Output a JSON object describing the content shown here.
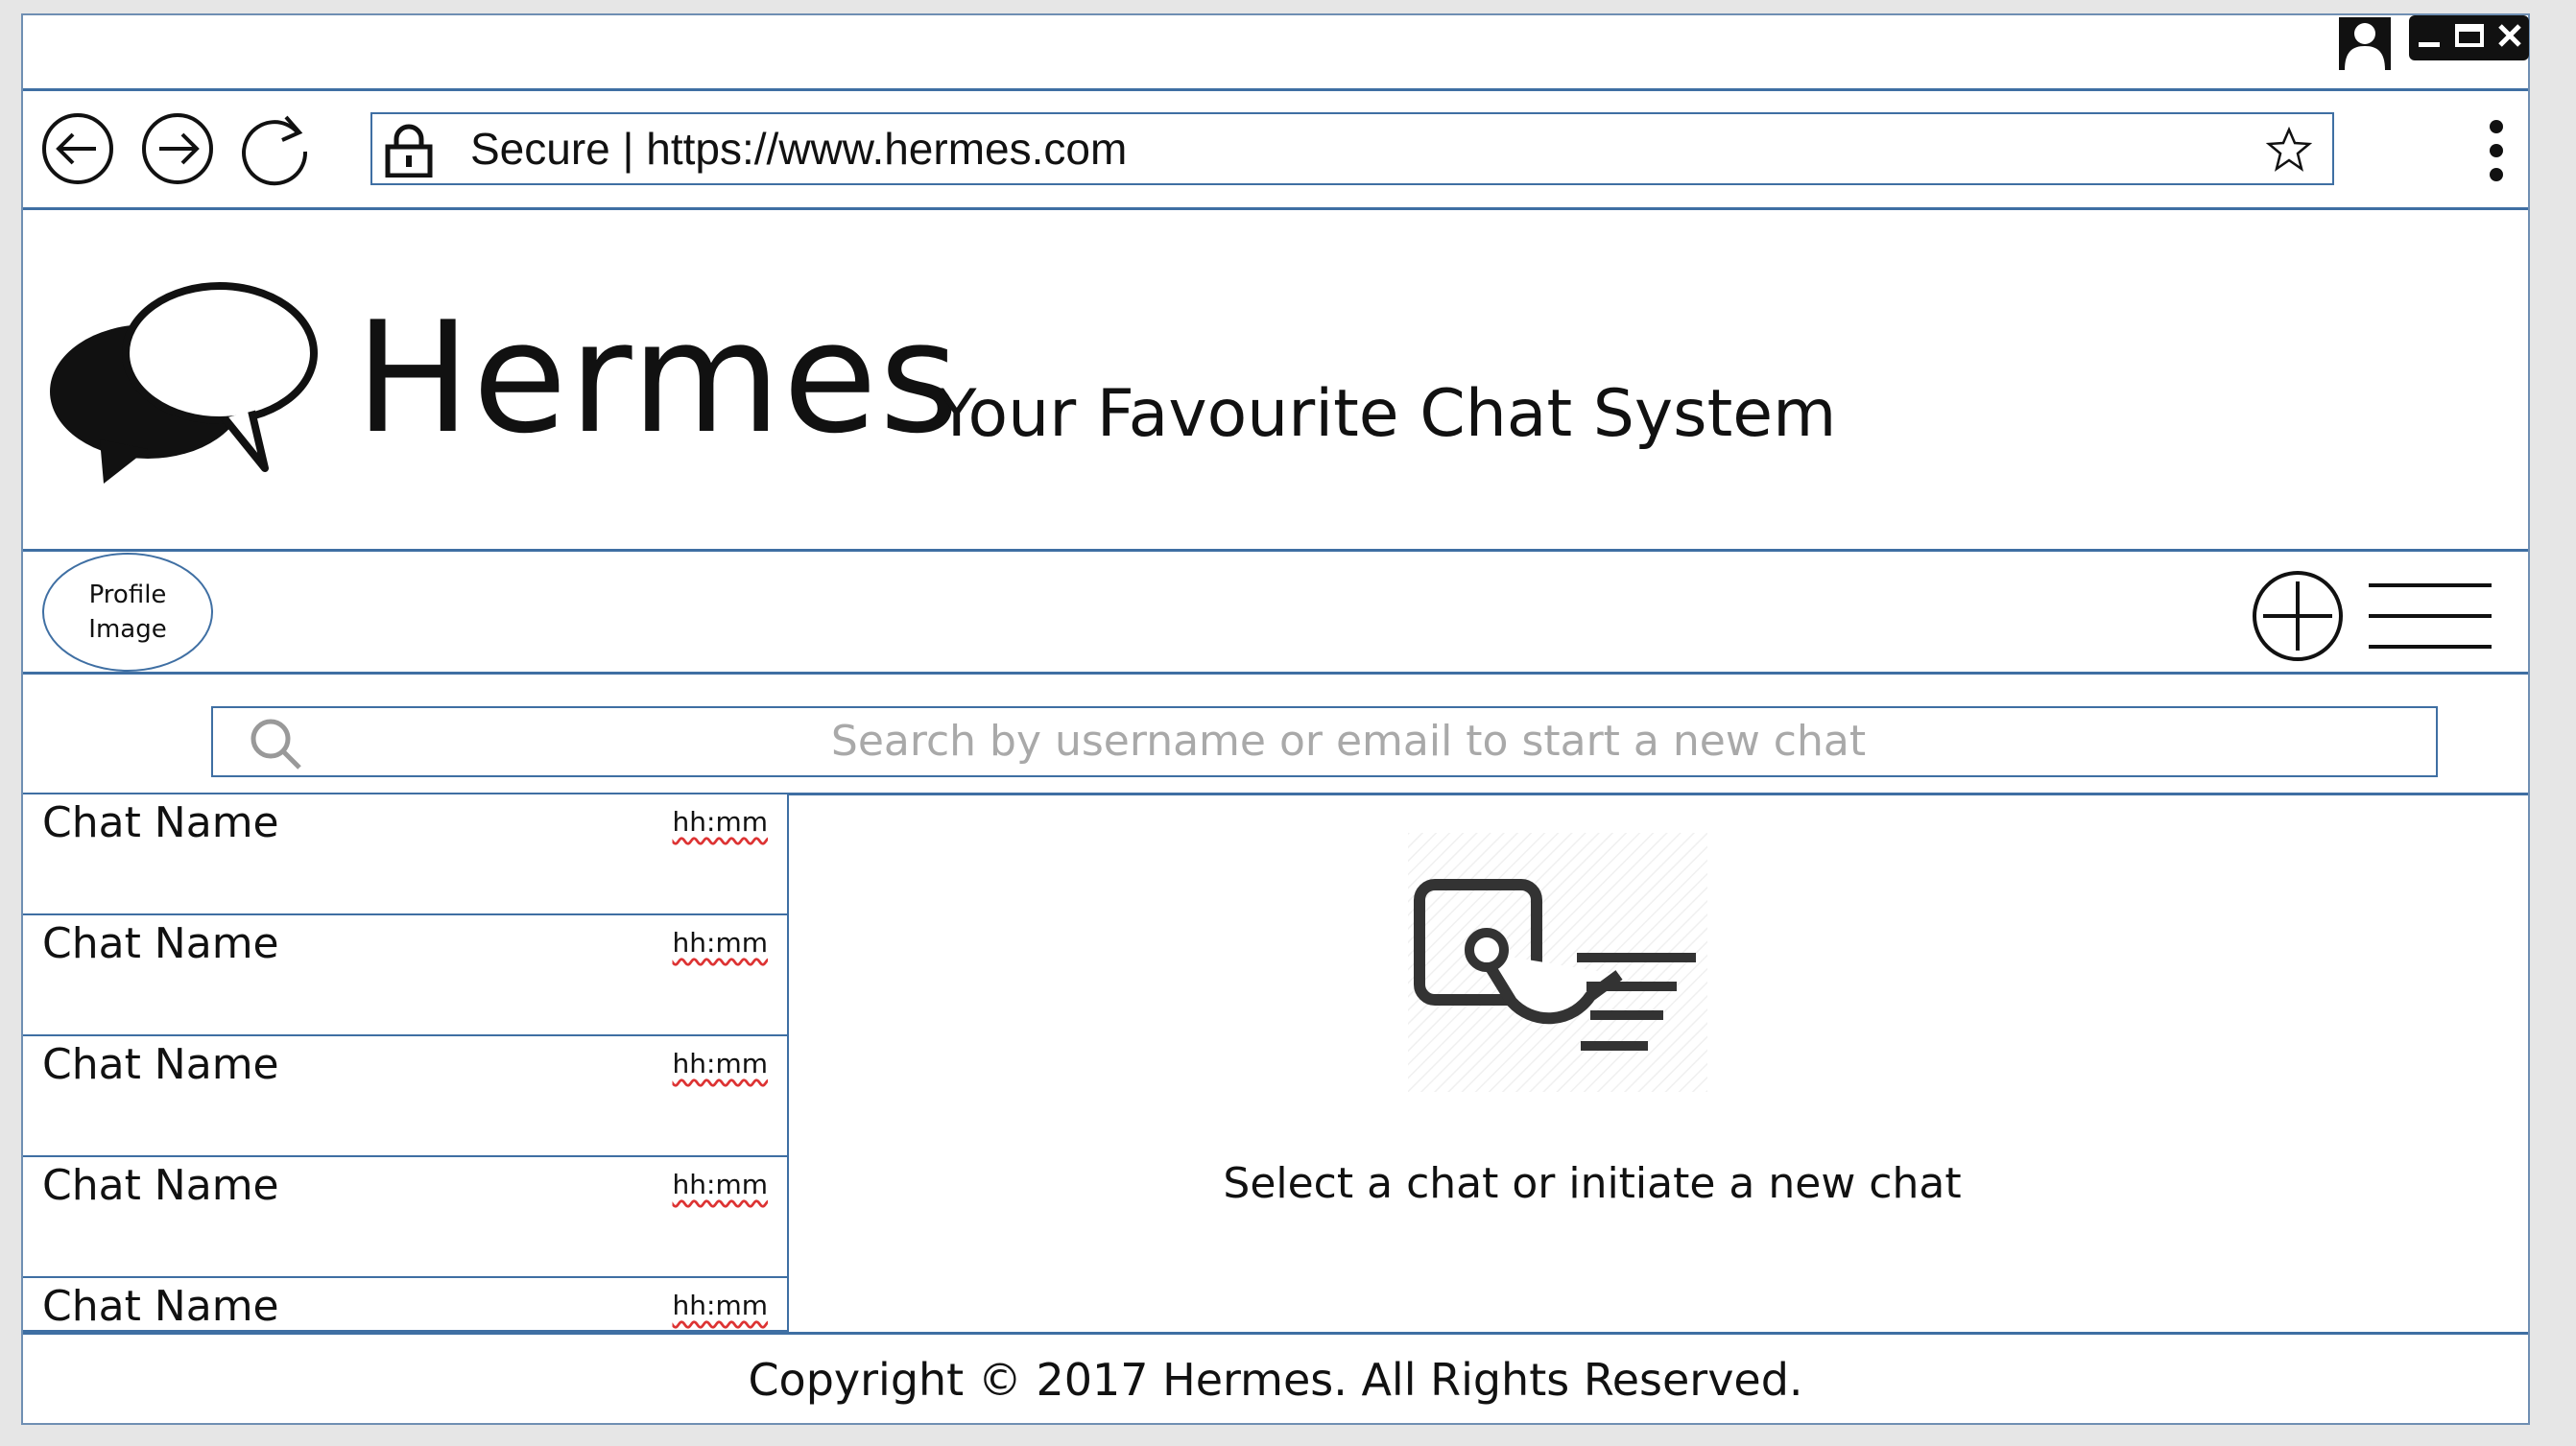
{
  "titlebar": {
    "user_icon": "user-icon",
    "controls": [
      "minimize-icon",
      "maximize-icon",
      "close-icon"
    ]
  },
  "browser": {
    "back_icon": "back-arrow-icon",
    "forward_icon": "forward-arrow-icon",
    "reload_icon": "reload-icon",
    "address_text": "Secure | https://www.hermes.com",
    "bookmark_icon": "star-icon",
    "menu_icon": "kebab-menu-icon"
  },
  "header": {
    "logo_icon": "chat-bubbles-icon",
    "app_name": "Hermes",
    "tagline": "Your Favourite Chat System"
  },
  "actions": {
    "profile_label": "Profile\nImage",
    "new_chat_icon": "plus-circle-icon",
    "menu_icon": "hamburger-icon"
  },
  "search": {
    "placeholder": "Search by username or email to start a new chat"
  },
  "chats": [
    {
      "name": "Chat Name",
      "time": "hh:mm"
    },
    {
      "name": "Chat Name",
      "time": "hh:mm"
    },
    {
      "name": "Chat Name",
      "time": "hh:mm"
    },
    {
      "name": "Chat Name",
      "time": "hh:mm"
    },
    {
      "name": "Chat Name",
      "time": "hh:mm"
    }
  ],
  "empty_state": {
    "icon": "touch-select-icon",
    "text": "Select a chat or initiate a new chat"
  },
  "footer": {
    "copyright": "Copyright © 2017 Hermes. All Rights Reserved."
  },
  "colors": {
    "border": "#3f6fa3",
    "placeholder": "#a9a9a9"
  }
}
